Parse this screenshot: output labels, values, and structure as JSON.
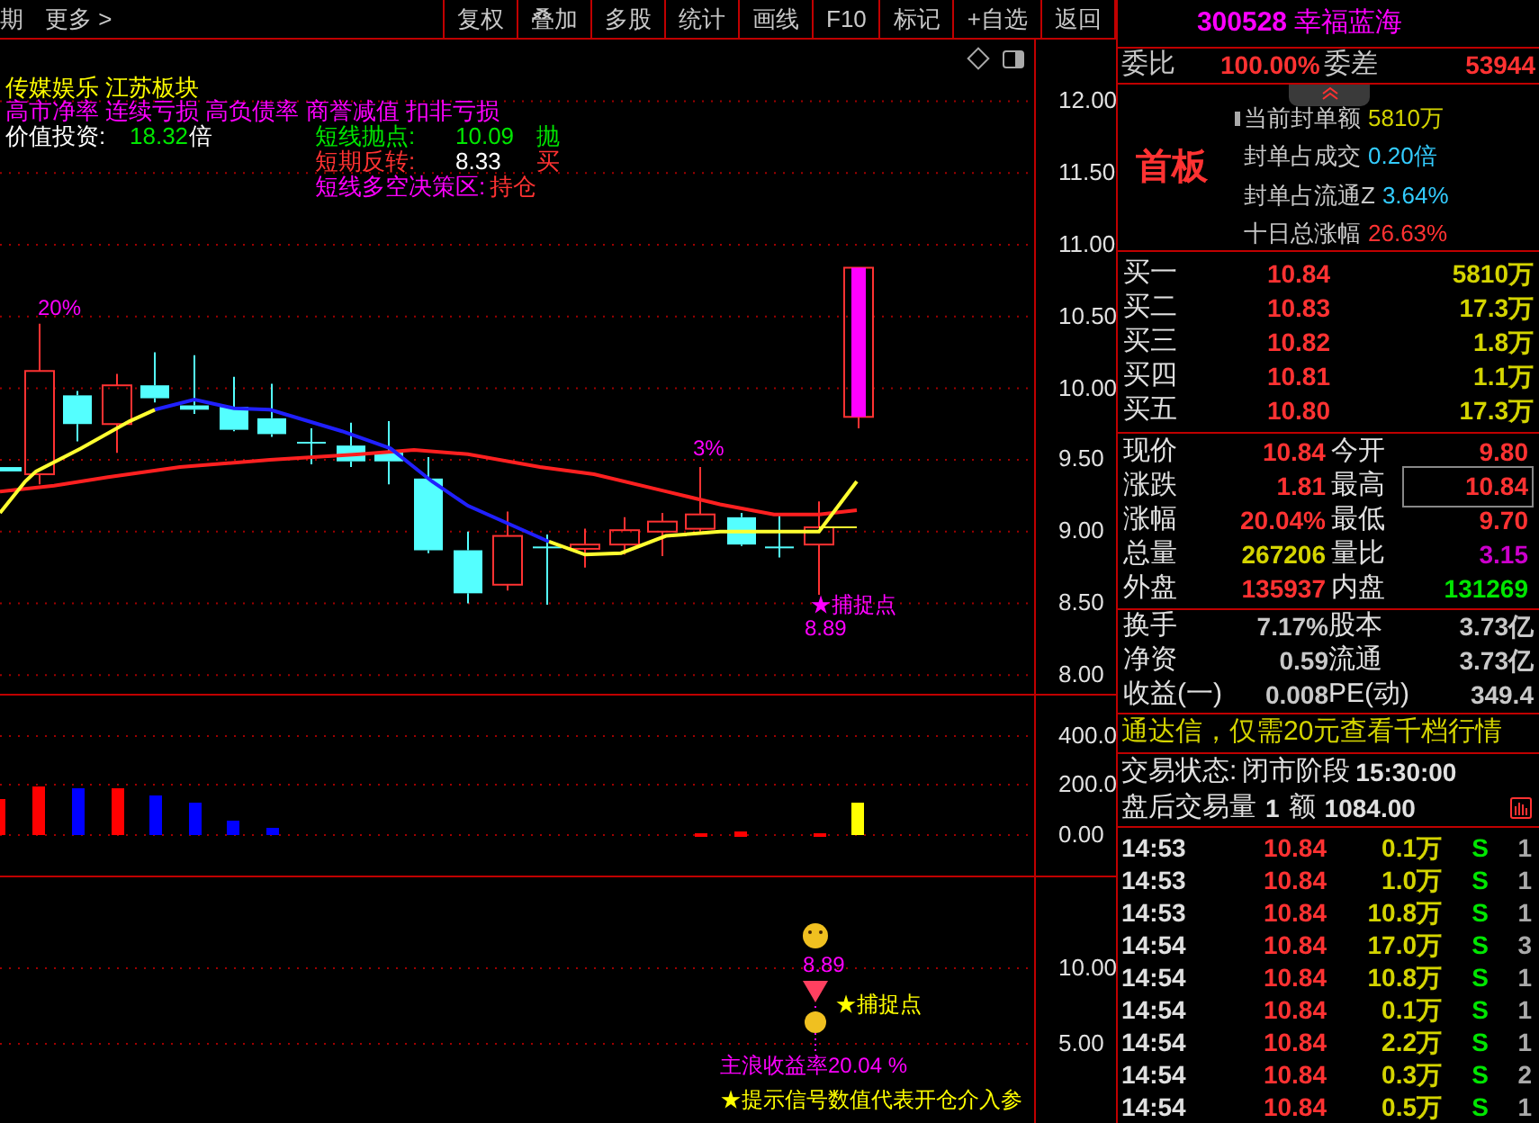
{
  "toolbar": {
    "left_items": [
      "期",
      "更多 >"
    ],
    "buttons": [
      "复权",
      "叠加",
      "多股",
      "统计",
      "画线",
      "F10",
      "标记",
      "+自选",
      "返回"
    ]
  },
  "main_chart": {
    "sector_tags": [
      "传媒娱乐",
      "江苏板块"
    ],
    "risk_tags": [
      "高市净率",
      "连续亏损",
      "高负债率",
      "商誉减值",
      "扣非亏损"
    ],
    "value_investing": {
      "label": "价值投资:",
      "value": "18.32",
      "unit": "倍"
    },
    "signals": [
      {
        "kind": "sell",
        "label": "短线抛点:",
        "value": "10.09",
        "action": "抛"
      },
      {
        "kind": "reversal",
        "label": "短期反转:",
        "value": "8.33",
        "action": "买"
      },
      {
        "kind": "zone",
        "label": "短线多空决策区:",
        "action": "持仓"
      }
    ],
    "annotations": [
      "20%",
      "3%",
      "★捕捉点",
      "8.89"
    ],
    "y_axis": [
      "12.00",
      "11.50",
      "11.00",
      "10.50",
      "10.00",
      "9.50",
      "9.00",
      "8.50",
      "8.00"
    ]
  },
  "volume_panel": {
    "y_axis": [
      "400.0",
      "200.0",
      "0.00"
    ]
  },
  "signal_panel": {
    "y_axis": [
      "10.00",
      "5.00"
    ],
    "price_label": "8.89",
    "capture_label": "★捕捉点",
    "return_label": "主浪收益率20.04 %",
    "hint": "★提示信号数值代表开仓介入参"
  },
  "stock": {
    "code": "300528",
    "name": "幸福蓝海"
  },
  "order_ratio": {
    "label": "委比",
    "value": "100.00%",
    "diff_label": "委差",
    "diff_value": "53944"
  },
  "seal_info": {
    "board": "首板",
    "lines": [
      {
        "label": "当前封单额",
        "value": "5810万",
        "color": "#d4d400"
      },
      {
        "label": "封单占成交",
        "value": "0.20倍",
        "color": "#33ccff"
      },
      {
        "label": "封单占流通Z",
        "value": "3.64%",
        "color": "#33ccff"
      },
      {
        "label": "十日总涨幅",
        "value": "26.63%",
        "color": "#ff3232"
      }
    ]
  },
  "order_book": [
    {
      "label": "买一",
      "price": "10.84",
      "volume": "5810万"
    },
    {
      "label": "买二",
      "price": "10.83",
      "volume": "17.3万"
    },
    {
      "label": "买三",
      "price": "10.82",
      "volume": "1.8万"
    },
    {
      "label": "买四",
      "price": "10.81",
      "volume": "1.1万"
    },
    {
      "label": "买五",
      "price": "10.80",
      "volume": "17.3万"
    }
  ],
  "quote": [
    [
      {
        "label": "现价",
        "value": "10.84",
        "kind": "up",
        "highlighted": false
      },
      {
        "label": "今开",
        "value": "9.80",
        "kind": "up",
        "highlighted": false
      }
    ],
    [
      {
        "label": "涨跌",
        "value": "1.81",
        "kind": "up",
        "highlighted": false
      },
      {
        "label": "最高",
        "value": "10.84",
        "kind": "up",
        "highlighted": true
      }
    ],
    [
      {
        "label": "涨幅",
        "value": "20.04%",
        "kind": "up",
        "highlighted": false
      },
      {
        "label": "最低",
        "value": "9.70",
        "kind": "up",
        "highlighted": false
      }
    ],
    [
      {
        "label": "总量",
        "value": "267206",
        "kind": "volume",
        "highlighted": false
      },
      {
        "label": "量比",
        "value": "3.15",
        "kind": "ratio",
        "highlighted": false
      }
    ],
    [
      {
        "label": "外盘",
        "value": "135937",
        "kind": "up",
        "highlighted": false
      },
      {
        "label": "内盘",
        "value": "131269",
        "kind": "down",
        "highlighted": false
      }
    ]
  ],
  "fundamentals": [
    [
      {
        "label": "换手",
        "value": "7.17%"
      },
      {
        "label": "股本",
        "value": "3.73亿"
      }
    ],
    [
      {
        "label": "净资",
        "value": "0.59"
      },
      {
        "label": "流通",
        "value": "3.73亿"
      }
    ],
    [
      {
        "label": "收益(一)",
        "value": "0.008"
      },
      {
        "label": "PE(动)",
        "value": "349.4"
      }
    ]
  ],
  "promo": "通达信，仅需20元查看千档行情",
  "trade_status": {
    "label": "交易状态:",
    "value": "闭市阶段",
    "time": "15:30:00"
  },
  "after_hours": {
    "label": "盘后交易量",
    "volume": "1",
    "amount_label": "额",
    "amount": "1084.00"
  },
  "trades": [
    {
      "time": "14:53",
      "price": "10.84",
      "volume": "0.1万",
      "side": "S",
      "count": "1"
    },
    {
      "time": "14:53",
      "price": "10.84",
      "volume": "1.0万",
      "side": "S",
      "count": "1"
    },
    {
      "time": "14:53",
      "price": "10.84",
      "volume": "10.8万",
      "side": "S",
      "count": "1"
    },
    {
      "time": "14:54",
      "price": "10.84",
      "volume": "17.0万",
      "side": "S",
      "count": "3"
    },
    {
      "time": "14:54",
      "price": "10.84",
      "volume": "10.8万",
      "side": "S",
      "count": "1"
    },
    {
      "time": "14:54",
      "price": "10.84",
      "volume": "0.1万",
      "side": "S",
      "count": "1"
    },
    {
      "time": "14:54",
      "price": "10.84",
      "volume": "2.2万",
      "side": "S",
      "count": "1"
    },
    {
      "time": "14:54",
      "price": "10.84",
      "volume": "0.3万",
      "side": "S",
      "count": "2"
    },
    {
      "time": "14:54",
      "price": "10.84",
      "volume": "0.5万",
      "side": "S",
      "count": "1"
    }
  ]
}
